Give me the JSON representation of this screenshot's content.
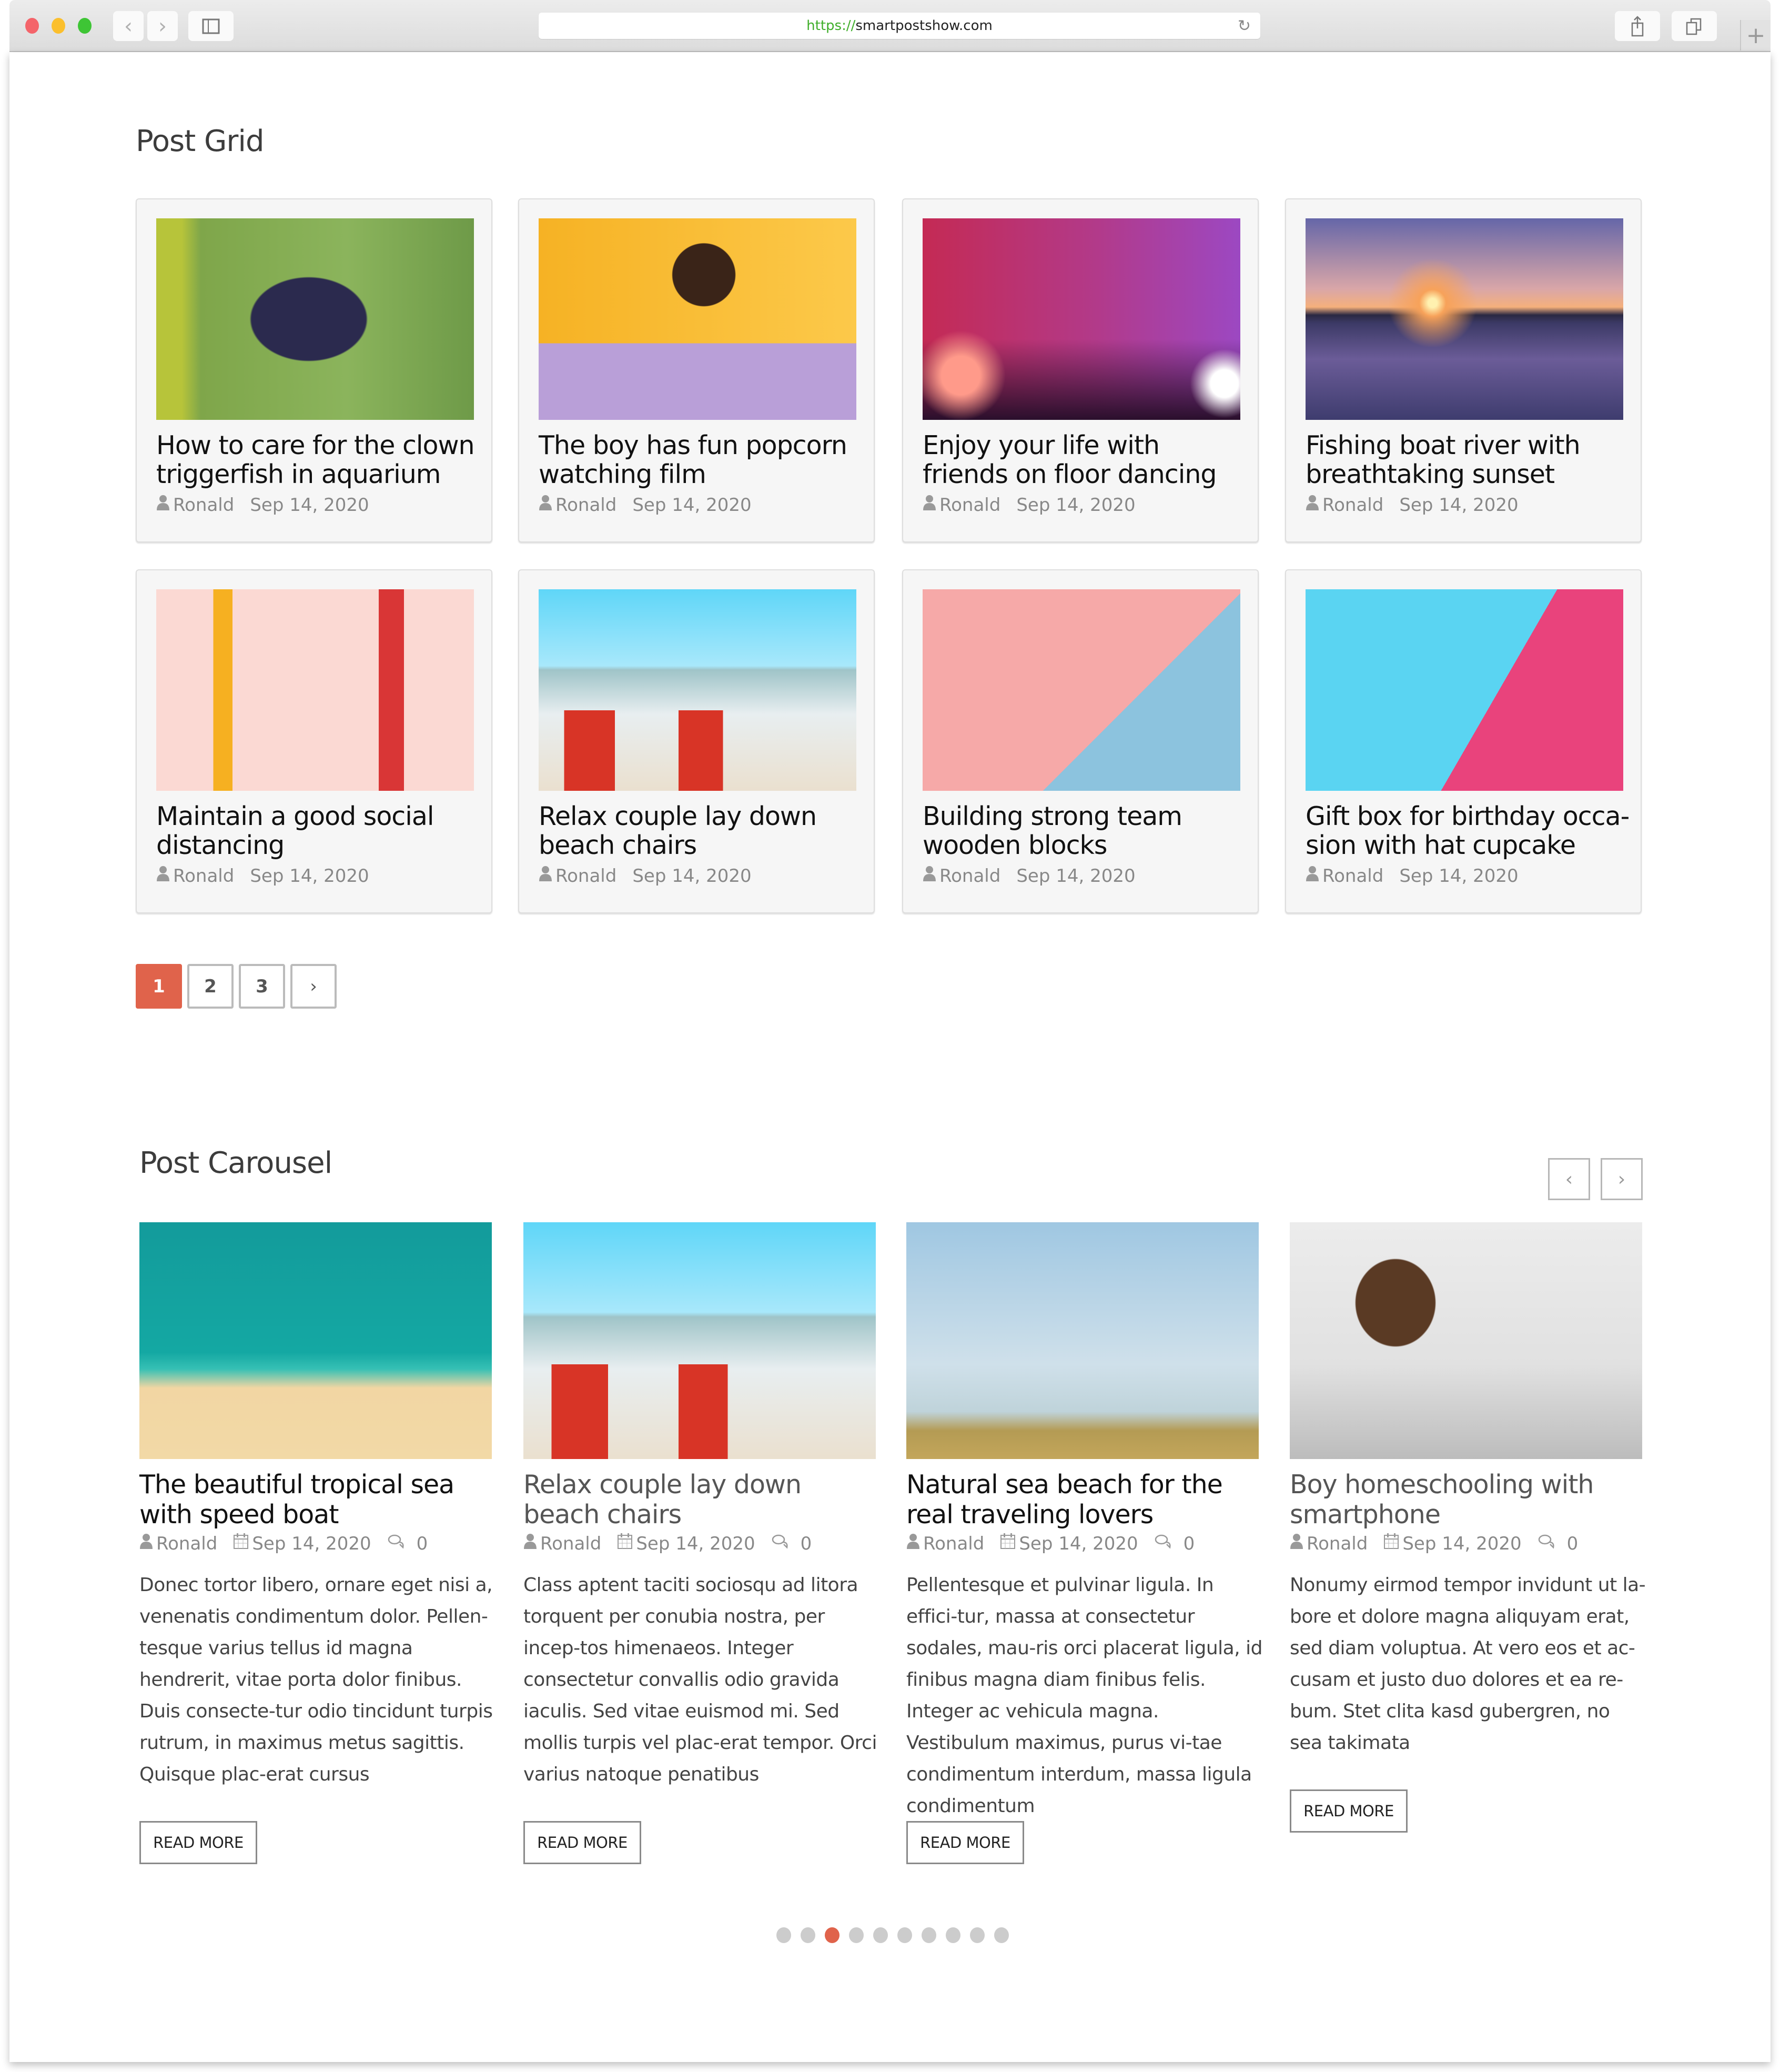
{
  "browser": {
    "url_scheme": "https://",
    "url_host": "smartpostshow.com",
    "back_icon": "chevron-left",
    "forward_icon": "chevron-right",
    "sidebar_icon": "sidebar",
    "reload_icon": "reload",
    "share_icon": "share",
    "tabs_icon": "tabs",
    "newtab_icon": "plus"
  },
  "post_grid": {
    "title": "Post Grid",
    "cards": [
      {
        "title": "How to care for the clown triggerfish in aquarium",
        "author": "Ronald",
        "date": "Sep 14, 2020",
        "image": "clown-triggerfish"
      },
      {
        "title": "The boy has fun popcorn watching film",
        "author": "Ronald",
        "date": "Sep 14, 2020",
        "image": "man-popcorn-3d-glasses"
      },
      {
        "title": "Enjoy your life with friends on floor dancing",
        "author": "Ronald",
        "date": "Sep 14, 2020",
        "image": "concert-crowd-hands"
      },
      {
        "title": "Fishing boat river with breathtaking sunset",
        "author": "Ronald",
        "date": "Sep 14, 2020",
        "image": "sunset-river-boats"
      },
      {
        "title": "Maintain a good social distancing",
        "author": "Ronald",
        "date": "Sep 14, 2020",
        "image": "social-distancing-illustration"
      },
      {
        "title": "Relax couple lay down beach chairs",
        "author": "Ronald",
        "date": "Sep 14, 2020",
        "image": "beach-chairs-couple"
      },
      {
        "title": "Building strong team wooden blocks",
        "author": "Ronald",
        "date": "Sep 14, 2020",
        "image": "team-wooden-blocks"
      },
      {
        "title": "Gift box for birthday occa-sion with hat cupcake",
        "author": "Ronald",
        "date": "Sep 14, 2020",
        "image": "birthday-cupcake-hat"
      }
    ],
    "pagination": {
      "pages": [
        "1",
        "2",
        "3"
      ],
      "current": "1",
      "next_label": "›"
    }
  },
  "post_carousel": {
    "title": "Post Carousel",
    "prev_label": "‹",
    "next_label": "›",
    "items": [
      {
        "title": "The beautiful tropical sea with speed boat",
        "author": "Ronald",
        "date": "Sep 14, 2020",
        "comments": "0",
        "excerpt": "Donec tortor libero, ornare eget nisi a, venenatis condimentum dolor. Pellen-tesque varius tellus id magna hendrerit, vitae porta dolor finibus. Duis consecte-tur odio tincidunt turpis rutrum, in maximus metus sagittis. Quisque plac-erat cursus",
        "button": "READ MORE",
        "image": "tropical-sea-boat"
      },
      {
        "title": "Relax couple lay down beach chairs",
        "author": "Ronald",
        "date": "Sep 14, 2020",
        "comments": "0",
        "excerpt": "Class aptent taciti sociosqu ad litora torquent per conubia nostra, per incep-tos himenaeos. Integer consectetur convallis odio gravida iaculis. Sed vitae euismod mi. Sed mollis turpis vel plac-erat tempor. Orci varius natoque penatibus",
        "button": "READ MORE",
        "image": "beach-chairs-couple"
      },
      {
        "title": "Natural sea beach for the real traveling lovers",
        "author": "Ronald",
        "date": "Sep 14, 2020",
        "comments": "0",
        "excerpt": "Pellentesque et pulvinar ligula. In effici-tur, massa at consectetur sodales, mau-ris orci placerat ligula, id finibus magna diam finibus felis. Integer ac vehicula magna. Vestibulum maximus, purus vi-tae condimentum interdum, massa ligula condimentum",
        "button": "READ MORE",
        "image": "palm-beach"
      },
      {
        "title": "Boy homeschooling with smartphone",
        "author": "Ronald",
        "date": "Sep 14, 2020",
        "comments": "0",
        "excerpt": "Nonumy eirmod tempor invidunt ut la-bore et dolore magna aliquyam erat, sed diam voluptua. At vero eos et ac-cusam et justo duo dolores et ea re-bum. Stet clita kasd gubergren, no sea takimata",
        "button": "READ MORE",
        "image": "boy-mask-smartphone"
      }
    ],
    "dots": {
      "count": 10,
      "active_index": 2
    }
  },
  "colors": {
    "accent": "#e0634b",
    "dot_inactive": "#cccccc",
    "card_bg": "#f6f6f6",
    "meta_text": "#888888",
    "url_scheme": "#3fae2a"
  }
}
